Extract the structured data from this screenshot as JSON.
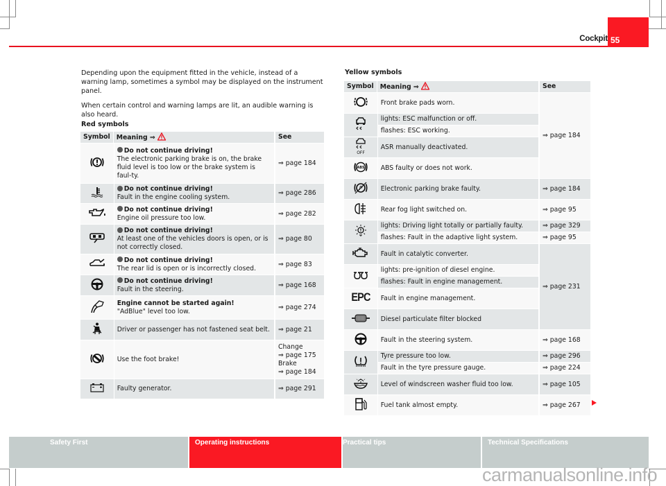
{
  "header": {
    "section_title": "Cockpit",
    "page_number": "55",
    "accent_color": "#fa1923"
  },
  "intro": {
    "paragraphs": [
      "Depending upon the equipment fitted in the vehicle, instead of a warning lamp, sometimes a symbol may be displayed on the instrument panel.",
      "When certain control and warning lamps are lit, an audible warning is also heard."
    ]
  },
  "red_symbols": {
    "title": "Red symbols",
    "columns": {
      "symbol": "Symbol",
      "meaning": "Meaning ⇒",
      "see": "See"
    },
    "rows": [
      {
        "icon": "brake-warning-icon",
        "bold": "Do not continue driving!",
        "text": "The electronic parking brake is on, the brake fluid level is too low or the brake system is faul-ty.",
        "see": "⇒ page 184"
      },
      {
        "icon": "coolant-temperature-icon",
        "bold": "Do not continue driving!",
        "text": "Fault in the engine cooling system.",
        "see": "⇒ page 286"
      },
      {
        "icon": "oil-pressure-icon",
        "bold": "Do not continue driving!",
        "text": "Engine oil pressure too low.",
        "see": "⇒ page 282"
      },
      {
        "icon": "door-open-icon",
        "bold": "Do not continue driving!",
        "text": "At least one of the vehicles doors is open, or is not correctly closed.",
        "see": "⇒ page 80"
      },
      {
        "icon": "rear-lid-open-icon",
        "bold": "Do not continue driving!",
        "text": "The rear lid is open or is incorrectly closed.",
        "see": "⇒ page 83"
      },
      {
        "icon": "steering-wheel-icon",
        "bold": "Do not continue driving!",
        "text": "Fault in the steering.",
        "see": "⇒ page 168"
      },
      {
        "icon": "adblue-icon",
        "bold": "Engine cannot be started again!",
        "text": "\"AdBlue\" level too low.",
        "see": "⇒ page 274"
      },
      {
        "icon": "seat-belt-icon",
        "bold": "",
        "text": "Driver or passenger has not fastened seat belt.",
        "see": "⇒ page 21"
      },
      {
        "icon": "foot-brake-icon",
        "bold": "",
        "text": "Use the foot brake!",
        "see_lines": [
          "Change",
          "⇒ page 175",
          "Brake",
          "⇒ page 184"
        ]
      },
      {
        "icon": "battery-icon",
        "bold": "",
        "text": "Faulty generator.",
        "see": "⇒ page 291"
      }
    ]
  },
  "yellow_symbols": {
    "title": "Yellow symbols",
    "columns": {
      "symbol": "Symbol",
      "meaning": "Meaning ⇒",
      "see": "See"
    },
    "rows": [
      {
        "icon": "brake-pads-icon",
        "text": "Front brake pads worn."
      },
      {
        "icon": "esc-icon",
        "text": "lights: ESC malfunction or off.",
        "text2": "flashes: ESC working."
      },
      {
        "icon": "asr-off-icon",
        "text": "ASR manually deactivated."
      },
      {
        "icon": "abs-icon",
        "text": "ABS faulty or does not work."
      },
      {
        "icon": "parking-brake-fault-icon",
        "text": "Electronic parking brake faulty.",
        "see": "⇒ page 184"
      },
      {
        "icon": "rear-fog-light-icon",
        "text": "Rear fog light switched on.",
        "see": "⇒ page 95"
      },
      {
        "icon": "light-fault-icon",
        "text": "lights: Driving light totally or partially faulty.",
        "see": "⇒ page 329",
        "text2": "flashes: Fault in the adaptive light system.",
        "see2": "⇒ page 95"
      },
      {
        "icon": "engine-check-icon",
        "text": "Fault in catalytic converter."
      },
      {
        "icon": "glow-plug-icon",
        "text": "lights: pre-ignition of diesel engine.",
        "text2": "flashes: Fault in engine management."
      },
      {
        "icon": "epc-icon",
        "icon_label": "EPC",
        "text": "Fault in engine management."
      },
      {
        "icon": "particulate-filter-icon",
        "text": "Diesel particulate filter blocked"
      },
      {
        "icon": "steering-wheel-icon",
        "text": "Fault in the steering system.",
        "see": "⇒ page 168"
      },
      {
        "icon": "tyre-pressure-icon",
        "text": "Tyre pressure too low.",
        "see": "⇒ page 296",
        "text2": "Fault in the tyre pressure gauge.",
        "see2": "⇒ page 224"
      },
      {
        "icon": "washer-fluid-icon",
        "text": "Level of windscreen washer fluid too low.",
        "see": "⇒ page 105"
      },
      {
        "icon": "fuel-icon",
        "text": "Fuel tank almost empty.",
        "see": "⇒ page 267"
      }
    ],
    "group_see_1": "⇒ page 184",
    "group_see_2": "⇒ page 231",
    "asr_icon_label": "OFF",
    "abs_icon_label": "ABS"
  },
  "footer_tabs": [
    {
      "label": "Safety First",
      "active": false
    },
    {
      "label": "Operating instructions",
      "active": true
    },
    {
      "label": "Practical tips",
      "active": false
    },
    {
      "label": "Technical Specifications",
      "active": false
    }
  ],
  "watermark": "carmanualsonline.info"
}
